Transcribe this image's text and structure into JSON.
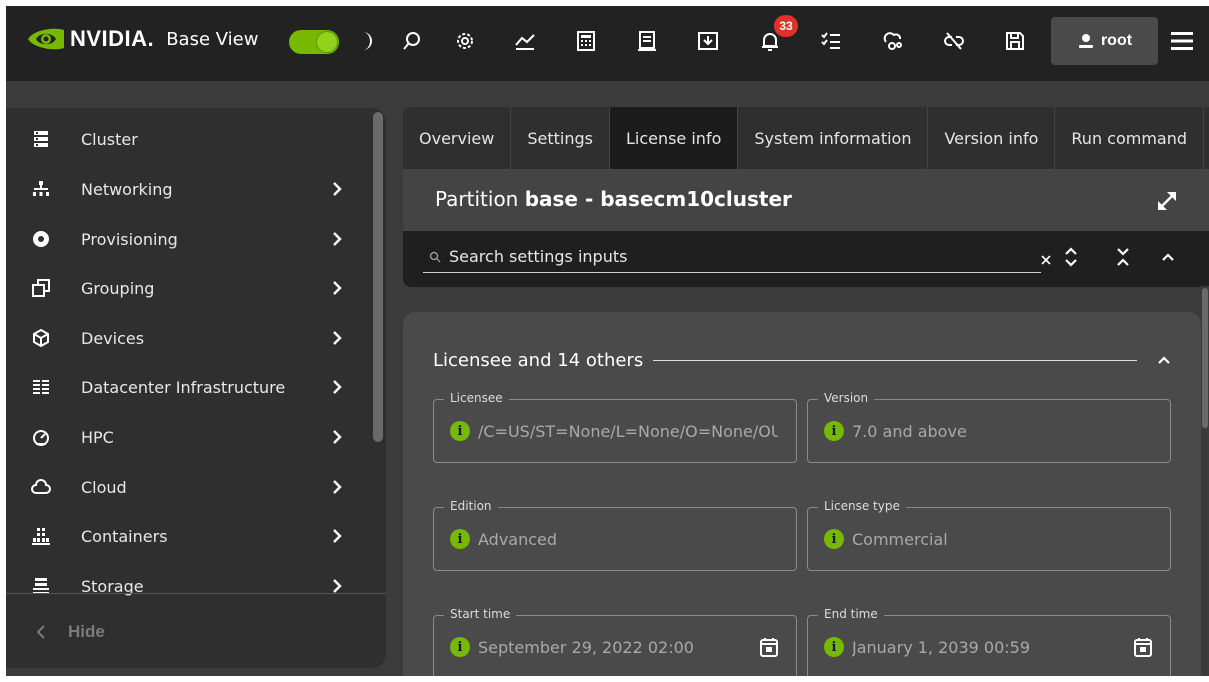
{
  "app": {
    "brand": "NVIDIA.",
    "product": "Base View",
    "notifications_count": "33",
    "user": "root"
  },
  "colors": {
    "accent": "#76b900",
    "badge": "#e0322b",
    "topbar": "#222222",
    "sidebar": "#2f2f2f",
    "content": "#4a4a4a"
  },
  "topbar_icons": [
    "theme-toggle",
    "moon-icon",
    "search-icon",
    "settings-icon",
    "chart-icon",
    "calculator-icon",
    "document-icon",
    "download-icon",
    "bell-icon",
    "task-list-icon",
    "cloud-gears-icon",
    "unlink-icon",
    "save-icon",
    "user-icon",
    "hamburger-menu-icon"
  ],
  "sidebar": {
    "items": [
      {
        "label": "Cluster",
        "icon": "server-icon",
        "has_submenu": false
      },
      {
        "label": "Networking",
        "icon": "network-icon",
        "has_submenu": true
      },
      {
        "label": "Provisioning",
        "icon": "disc-icon",
        "has_submenu": true
      },
      {
        "label": "Grouping",
        "icon": "grouping-icon",
        "has_submenu": true
      },
      {
        "label": "Devices",
        "icon": "cube-icon",
        "has_submenu": true
      },
      {
        "label": "Datacenter Infrastructure",
        "icon": "rack-icon",
        "has_submenu": true
      },
      {
        "label": "HPC",
        "icon": "gauge-icon",
        "has_submenu": true
      },
      {
        "label": "Cloud",
        "icon": "cloud-icon",
        "has_submenu": true
      },
      {
        "label": "Containers",
        "icon": "containers-icon",
        "has_submenu": true
      },
      {
        "label": "Storage",
        "icon": "storage-icon",
        "has_submenu": true
      }
    ],
    "hide_label": "Hide"
  },
  "tabs": [
    {
      "label": "Overview",
      "active": false
    },
    {
      "label": "Settings",
      "active": false
    },
    {
      "label": "License info",
      "active": true
    },
    {
      "label": "System information",
      "active": false
    },
    {
      "label": "Version info",
      "active": false
    },
    {
      "label": "Run command",
      "active": false
    }
  ],
  "partition": {
    "prefix": "Partition",
    "name": "base - basecm10cluster"
  },
  "search": {
    "placeholder": "Search settings inputs"
  },
  "section": {
    "title": "Licensee and 14 others"
  },
  "fields": [
    {
      "label": "Licensee",
      "value": "/C=US/ST=None/L=None/O=None/OU",
      "calendar": false
    },
    {
      "label": "Version",
      "value": "7.0 and above",
      "calendar": false
    },
    {
      "label": "Edition",
      "value": "Advanced",
      "calendar": false
    },
    {
      "label": "License type",
      "value": "Commercial",
      "calendar": false
    },
    {
      "label": "Start time",
      "value": "September 29, 2022 02:00",
      "calendar": true
    },
    {
      "label": "End time",
      "value": "January 1, 2039 00:59",
      "calendar": true
    }
  ]
}
